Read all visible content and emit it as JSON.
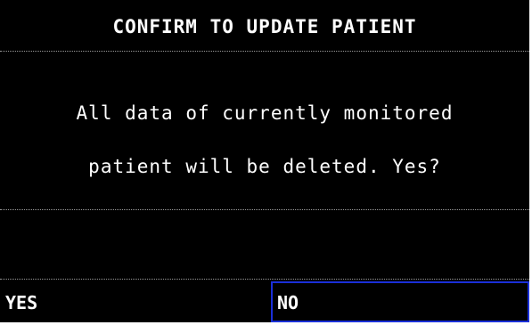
{
  "dialog": {
    "title": "CONFIRM TO UPDATE PATIENT",
    "message_line1": "All data of currently monitored",
    "message_line2": "patient will be deleted. Yes?",
    "yes_label": "YES",
    "no_label": "NO",
    "selected_button": "NO"
  },
  "colors": {
    "background": "#000000",
    "text": "#ffffff",
    "focus_border": "#1a2fd8",
    "divider": "#9a9a9a"
  }
}
